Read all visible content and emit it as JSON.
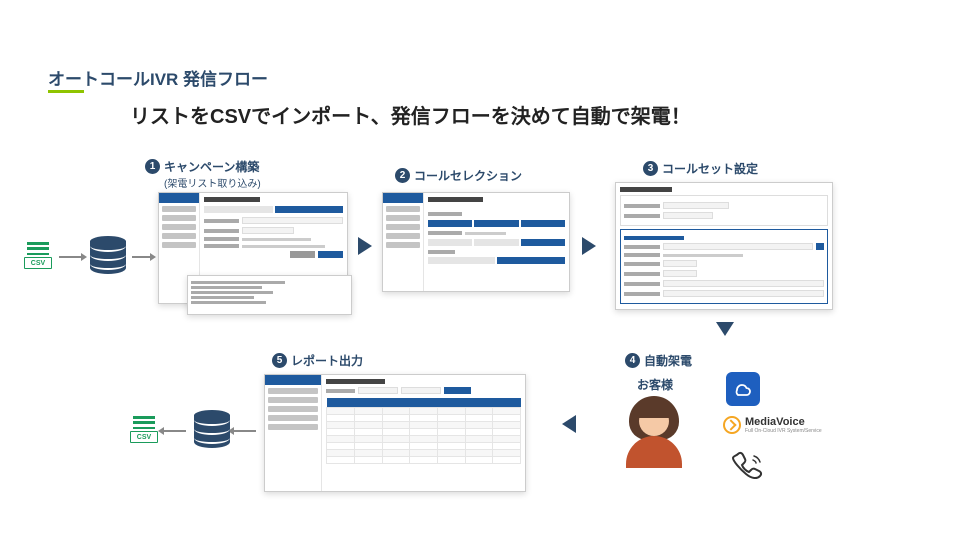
{
  "page_title": "オートコールIVR 発信フロー",
  "headline": "リストをCSVでインポート、発信フローを決めて自動で架電！",
  "steps": {
    "s1": {
      "label": "キャンペーン構築",
      "sub": "(架電リスト取り込み)"
    },
    "s2": {
      "label": "コールセレクション"
    },
    "s3": {
      "label": "コールセット設定"
    },
    "s4": {
      "label": "自動架電"
    },
    "s5": {
      "label": "レポート出力"
    }
  },
  "csv_label": "CSV",
  "customer_label": "お客様",
  "media_voice": {
    "name": "MediaVoice",
    "tagline": "Full On-Cloud IVR System/Service"
  },
  "colors": {
    "brand": "#2c4a6b",
    "accent": "#1e5a9e",
    "green": "#1a9b5b",
    "lime": "#8fc400"
  }
}
